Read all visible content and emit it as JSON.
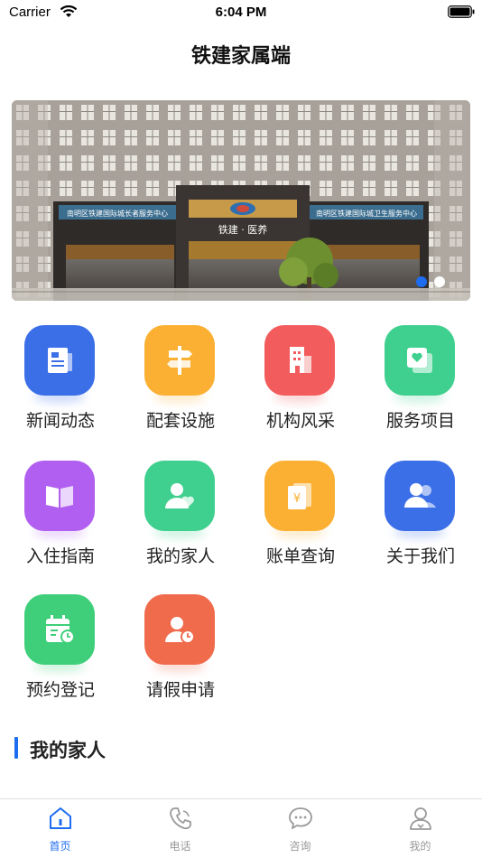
{
  "status": {
    "carrier": "Carrier",
    "time": "6:04 PM"
  },
  "nav": {
    "title": "铁建家属端"
  },
  "banner": {
    "image": "building-photo",
    "sign_left": "南明区铁建国际城长者服务中心",
    "sign_right": "南明区铁建国际城卫生服务中心",
    "sign_center": "铁建 · 医养",
    "slide_count": 2,
    "active_slide": 1
  },
  "menu": [
    {
      "label": "新闻动态",
      "icon": "news-icon",
      "color": "#3b6fe8"
    },
    {
      "label": "配套设施",
      "icon": "signpost-icon",
      "color": "#fbb033"
    },
    {
      "label": "机构风采",
      "icon": "building-icon",
      "color": "#f25c5c"
    },
    {
      "label": "服务项目",
      "icon": "service-icon",
      "color": "#3fcf8e"
    },
    {
      "label": "入住指南",
      "icon": "book-icon",
      "color": "#b15ff0"
    },
    {
      "label": "我的家人",
      "icon": "family-icon",
      "color": "#3fcf8e"
    },
    {
      "label": "账单查询",
      "icon": "bill-icon",
      "color": "#fbb033"
    },
    {
      "label": "关于我们",
      "icon": "about-icon",
      "color": "#3b6fe8"
    },
    {
      "label": "预约登记",
      "icon": "calendar-icon",
      "color": "#3fcf7a"
    },
    {
      "label": "请假申请",
      "icon": "leave-icon",
      "color": "#f06a4c"
    }
  ],
  "section": {
    "title": "我的家人"
  },
  "tabs": [
    {
      "label": "首页",
      "icon": "home-icon",
      "active": true
    },
    {
      "label": "电话",
      "icon": "phone-icon",
      "active": false
    },
    {
      "label": "咨询",
      "icon": "chat-icon",
      "active": false
    },
    {
      "label": "我的",
      "icon": "profile-icon",
      "active": false
    }
  ],
  "colors": {
    "accent": "#1e6cf0",
    "inactive": "#999999"
  }
}
